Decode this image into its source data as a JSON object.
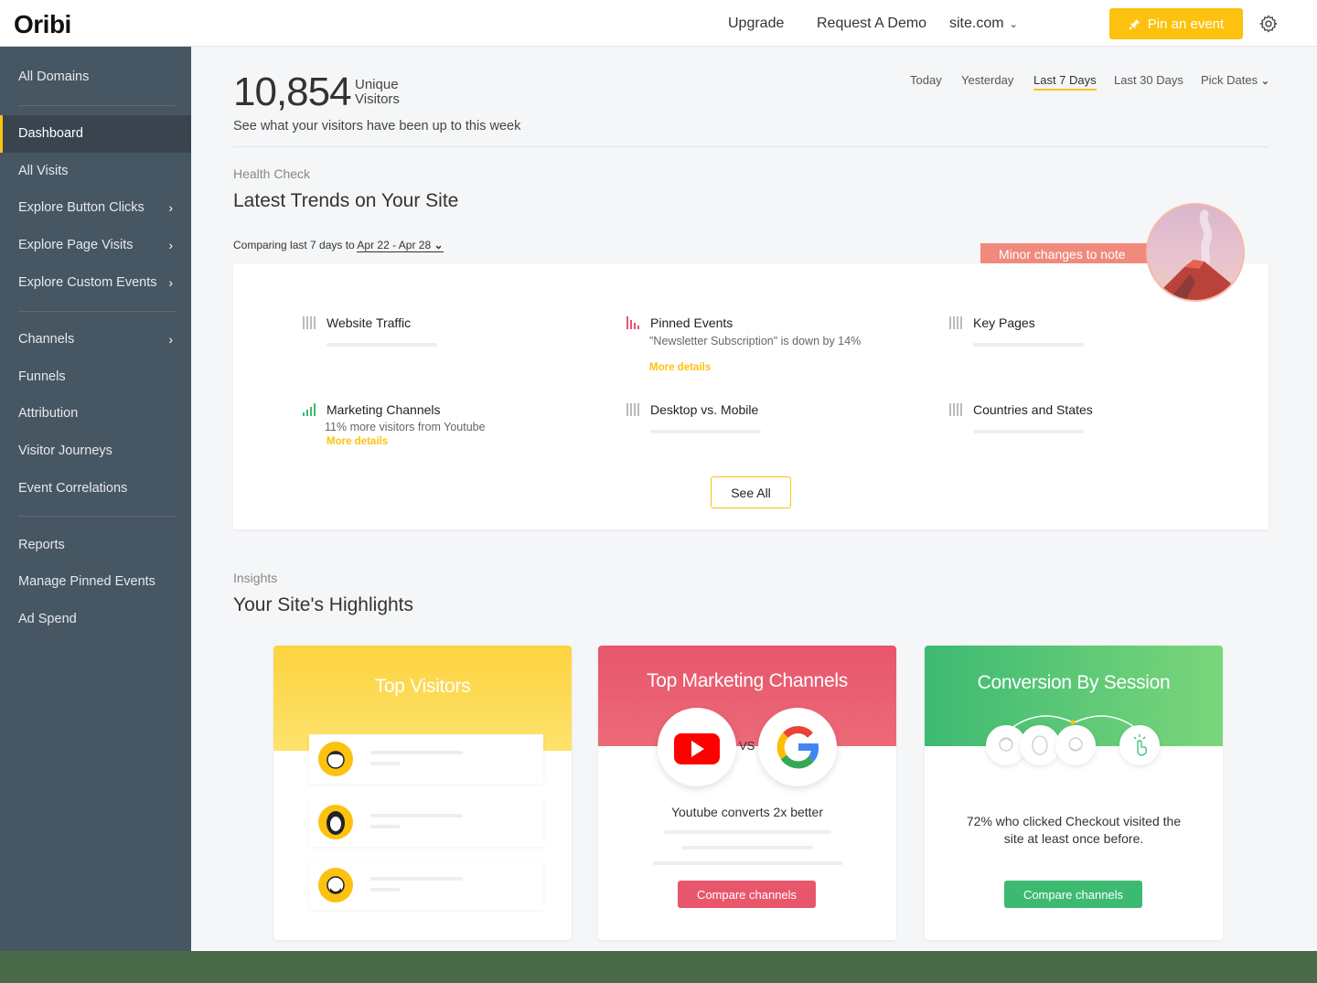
{
  "app": {
    "logo": "Oribi"
  },
  "topnav": {
    "upgrade": "Upgrade",
    "request_demo": "Request A Demo",
    "site": "site.com",
    "pin_button": "Pin an event"
  },
  "sidebar": {
    "all_domains": "All Domains",
    "items": [
      {
        "label": "Dashboard"
      },
      {
        "label": "All Visits"
      },
      {
        "label": "Explore Button Clicks"
      },
      {
        "label": "Explore Page Visits"
      },
      {
        "label": "Explore Custom Events"
      },
      {
        "label": "Channels"
      },
      {
        "label": "Funnels"
      },
      {
        "label": "Attribution"
      },
      {
        "label": "Visitor Journeys"
      },
      {
        "label": "Event Correlations"
      },
      {
        "label": "Reports"
      },
      {
        "label": "Manage Pinned Events"
      },
      {
        "label": "Ad Spend"
      }
    ],
    "active": "Dashboard"
  },
  "header": {
    "visitor_count": "10,854",
    "unique_line1": "Unique",
    "unique_line2": "Visitors",
    "subtitle": "See what your visitors have been up to this week",
    "ranges": [
      "Today",
      "Yesterday",
      "Last 7 Days",
      "Last 30 Days",
      "Pick Dates"
    ],
    "active_range": "Last 7 Days"
  },
  "health": {
    "kicker": "Health Check",
    "title": "Latest Trends on Your Site",
    "comparing_prefix": "Comparing last 7 days to",
    "comparing_range": "Apr 22 - Apr 28",
    "minor_note": "Minor changes to note",
    "trends": [
      {
        "title": "Website Traffic",
        "desc": "",
        "more": ""
      },
      {
        "title": "Pinned Events",
        "desc": "\"Newsletter Subscription\" is down by 14%",
        "more": "More details"
      },
      {
        "title": "Key Pages",
        "desc": "",
        "more": ""
      },
      {
        "title": "Marketing Channels",
        "desc": "11% more visitors from Youtube",
        "more": "More details"
      },
      {
        "title": "Desktop vs. Mobile",
        "desc": "",
        "more": ""
      },
      {
        "title": "Countries and States",
        "desc": "",
        "more": ""
      }
    ],
    "see_all": "See All"
  },
  "insights": {
    "kicker": "Insights",
    "title": "Your Site's Highlights",
    "cards": [
      {
        "title": "Top Visitors",
        "color": "#fdd33f"
      },
      {
        "title": "Top Marketing Channels",
        "color": "#e8566c",
        "text": "Youtube converts 2x better",
        "vs": "VS",
        "button": "Compare channels"
      },
      {
        "title": "Conversion By Session",
        "color": "#3dba72",
        "text_line1": "72% who clicked Checkout visited the",
        "text_line2": "site at least once before.",
        "button": "Compare channels"
      }
    ]
  }
}
